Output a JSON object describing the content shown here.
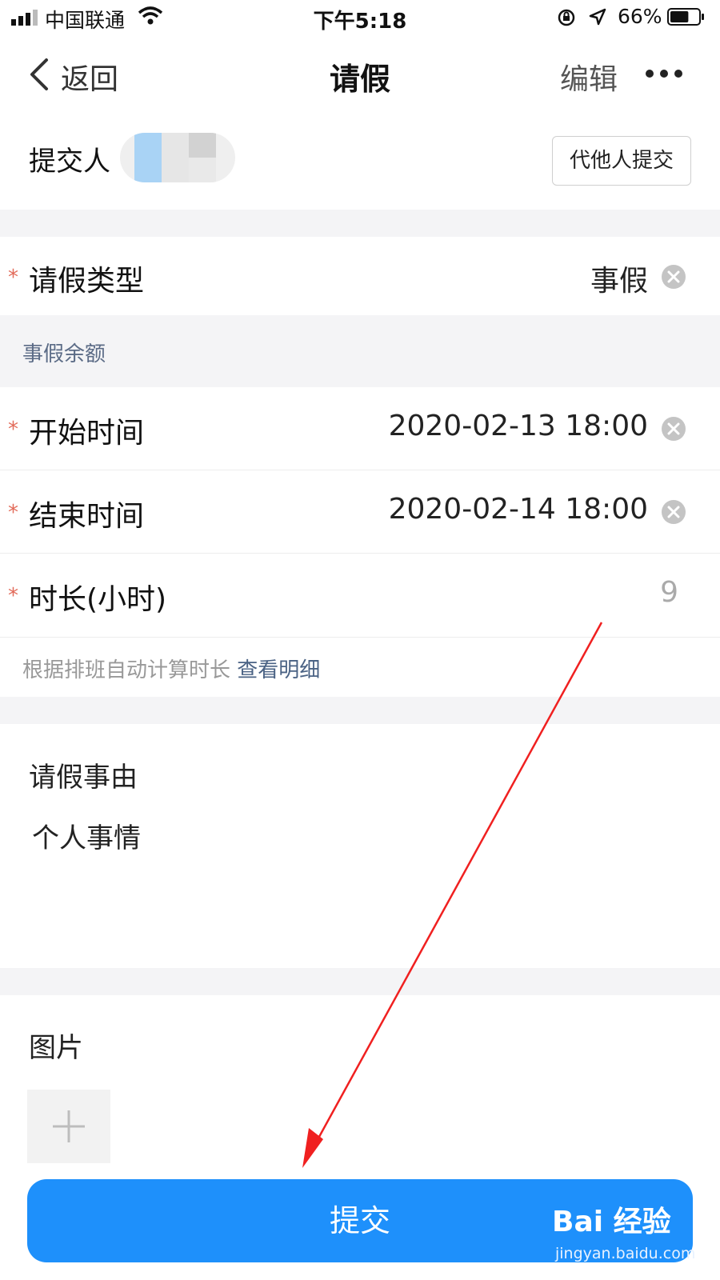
{
  "status_bar": {
    "carrier": "中国联通",
    "time": "下午5:18",
    "battery": "66%",
    "battery_level": 0.66
  },
  "nav": {
    "back_label": "返回",
    "title": "请假",
    "edit_label": "编辑"
  },
  "submitter": {
    "label": "提交人",
    "proxy_button": "代他人提交"
  },
  "form": {
    "leave_type": {
      "label": "请假类型",
      "value": "事假",
      "required": "*"
    },
    "balance_text": "事假余额",
    "start_time": {
      "label": "开始时间",
      "value": "2020-02-13 18:00",
      "required": "*"
    },
    "end_time": {
      "label": "结束时间",
      "value": "2020-02-14 18:00",
      "required": "*"
    },
    "duration": {
      "label": "时长(小时)",
      "value": "9",
      "required": "*"
    },
    "auto_calc_text": "根据排班自动计算时长",
    "view_details_link": "查看明细",
    "reason": {
      "label": "请假事由",
      "value": "个人事情"
    },
    "images": {
      "label": "图片"
    }
  },
  "submit_button": "提交",
  "watermark": {
    "brand": "Bai 经验",
    "site": "jingyan.baidu.com"
  },
  "colors": {
    "accent": "#1e90fb",
    "required": "#e26b5a",
    "annotation_arrow": "#f02020"
  }
}
